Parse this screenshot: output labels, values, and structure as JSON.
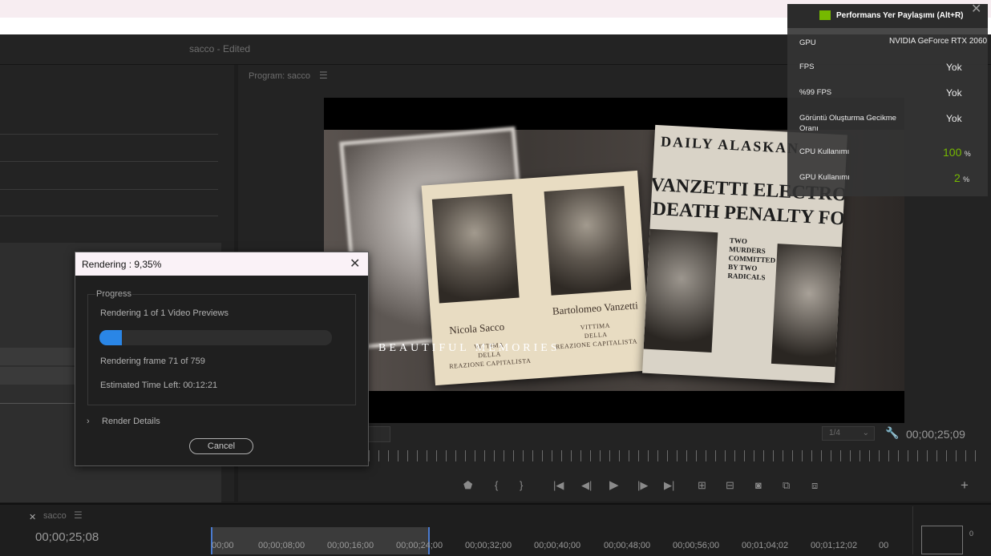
{
  "app": {
    "title": "sacco  - Edited"
  },
  "program_monitor": {
    "title": "Program: sacco",
    "menu_icon": "hamburger-icon",
    "overlay_text": "BEAUTIFUL MEMORIES",
    "fit_value": "",
    "resolution": "1/4",
    "timecode": "00;00;25;09",
    "card_names": [
      "Nicola Sacco",
      "Bartolomeo Vanzetti"
    ],
    "card_subtitle": "VITTIMA\nDELLA\nREAZIONE CAPITALISTA",
    "newspaper": {
      "masthead": "DAILY ALASKAN",
      "headline1": "VANZETTI ELECTROCUTED",
      "headline2": "DEATH PENALTY FOR",
      "sub": "TWO MURDERS COMMITTED BY TWO RADICALS"
    }
  },
  "timeline": {
    "sequence_name": "sacco",
    "timecode": "00;00;25;08",
    "ticks": [
      "00;00",
      "00;00;08;00",
      "00;00;16;00",
      "00;00;24;00",
      "00;00;32;00",
      "00;00;40;00",
      "00;00;48;00",
      "00;00;56;00",
      "00;01;04;02",
      "00;01;12;02",
      "00"
    ],
    "meter_zero": "0"
  },
  "nvidia_overlay": {
    "title": "Performans Yer Paylaşımı (Alt+R)",
    "rows": [
      {
        "label": "GPU",
        "value": "NVIDIA GeForce RTX 2060"
      },
      {
        "label": "FPS",
        "value": "Yok"
      },
      {
        "label": "%99 FPS",
        "value": "Yok"
      },
      {
        "label": "Görüntü Oluşturma Gecikme Oranı",
        "value": "Yok"
      },
      {
        "label": "CPU Kullanımı",
        "value": "100",
        "unit": "%"
      },
      {
        "label": "GPU Kullanımı",
        "value": "2",
        "unit": "%"
      }
    ],
    "accent": "#76b900"
  },
  "render_dialog": {
    "title": "Rendering : 9,35%",
    "group_label": "Progress",
    "status": "Rendering 1 of 1 Video Previews",
    "progress_fraction": 0.0935,
    "frame_text": "Rendering frame 71 of 759",
    "time_left": "Estimated Time Left: 00:12:21",
    "details_label": "Render Details",
    "cancel_label": "Cancel",
    "accent": "#2a86e6"
  }
}
